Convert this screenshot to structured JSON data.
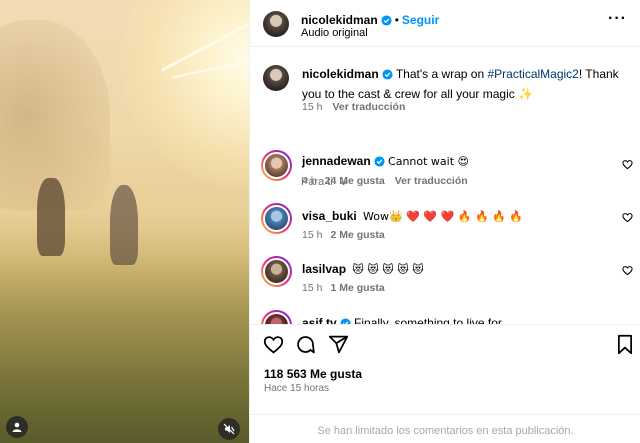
{
  "post": {
    "author": "nicolekidman",
    "follow_label": "Seguir",
    "separator": "•",
    "audio": "Audio original",
    "caption_prefix": "That's a wrap on ",
    "caption_hashtag": "#PracticalMagic2",
    "caption_suffix": "! Thank you to the cast & crew for all your magic ✨",
    "caption_time": "15 h",
    "caption_translate": "Ver traducción"
  },
  "sort_label": "Para ti",
  "comments": [
    {
      "user": "jennadewan",
      "verified": true,
      "text": "Cannot wait 😍",
      "time": "4 h",
      "likes": "24 Me gusta",
      "translate": "Ver traducción"
    },
    {
      "user": "visa_buki",
      "verified": false,
      "text": "Wow👑 ❤️ ❤️ ❤️ 🔥 🔥 🔥 🔥",
      "time": "15 h",
      "likes": "2 Me gusta"
    },
    {
      "user": "lasilvap",
      "verified": false,
      "text": "😻 😻 😻 😻 😻",
      "time": "15 h",
      "likes": "1 Me gusta"
    },
    {
      "user": "asif.tv",
      "verified": true,
      "text": "Finally, something to live for"
    }
  ],
  "actions": {
    "likes": "118 563 Me gusta",
    "posted": "Hace 15 horas",
    "comments_limited": "Se han limitado los comentarios en esta publicación."
  },
  "icons": {
    "verified": "verified-badge-icon",
    "more": "more-options-icon",
    "like": "heart-icon",
    "comment": "comment-icon",
    "share": "share-icon",
    "save": "bookmark-icon",
    "tags": "user-tag-icon",
    "mute": "mute-icon"
  },
  "colors": {
    "link": "#0095f6",
    "hashtag": "#00376b",
    "muted": "#737373",
    "border": "#efefef"
  }
}
